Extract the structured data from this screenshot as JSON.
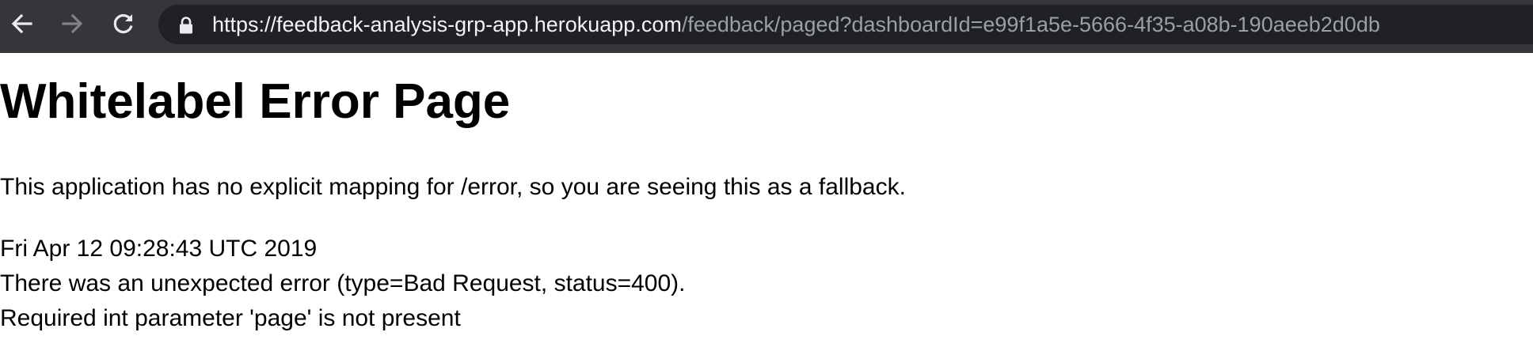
{
  "browser": {
    "url_host": "https://feedback-analysis-grp-app.herokuapp.com",
    "url_path": "/feedback/paged?dashboardId=e99f1a5e-5666-4f35-a08b-190aeeb2d0db",
    "icons": {
      "back": "arrow-left-icon",
      "forward": "arrow-right-icon",
      "reload": "reload-icon",
      "secure": "lock-icon"
    },
    "colors": {
      "toolbar": "#35363a",
      "omnibox": "#202124",
      "host_text": "#f1f3f4",
      "path_text": "#9aa0a6"
    }
  },
  "page": {
    "title": "Whitelabel Error Page",
    "description": "This application has no explicit mapping for /error, so you are seeing this as a fallback.",
    "timestamp": "Fri Apr 12 09:28:43 UTC 2019",
    "error_line": "There was an unexpected error (type=Bad Request, status=400).",
    "error_message": "Required int parameter 'page' is not present"
  }
}
